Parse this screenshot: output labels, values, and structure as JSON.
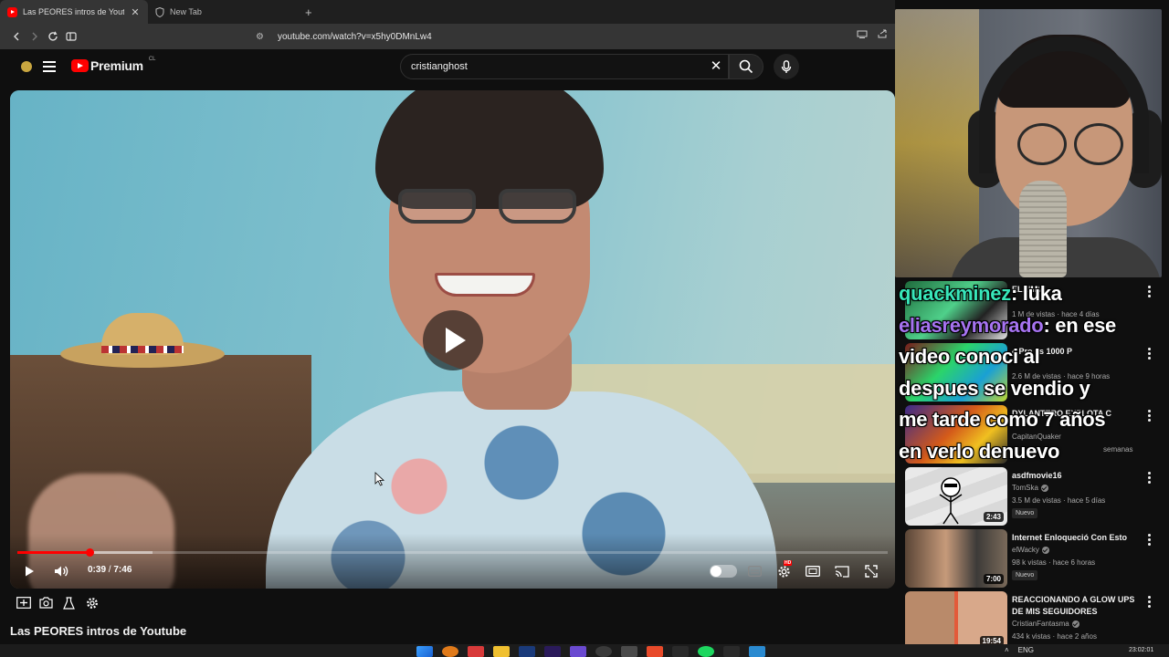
{
  "browser": {
    "tabs": [
      {
        "label": "Las PEORES intros de Youtube -",
        "icon": "youtube-favicon",
        "active": true
      },
      {
        "label": "New Tab",
        "icon": "shield-icon",
        "active": false
      }
    ],
    "new_tab_label": "+",
    "url": "youtube.com/watch?v=x5hy0DMnLw4"
  },
  "youtube": {
    "logo_text": "Premium",
    "country_code": "CL",
    "search_value": "cristianghost",
    "colors": {
      "brand": "#ff0000",
      "background": "#0f0f0f"
    }
  },
  "player": {
    "current_time": "0:39",
    "separator": " / ",
    "duration": "7:46",
    "progress_fraction": 0.0837,
    "buffered_fraction": 0.155,
    "hd_badge": "HD"
  },
  "video_title": "Las PEORES intros de Youtube",
  "chat": [
    {
      "user": "quackminez",
      "text": "lüka"
    },
    {
      "user": "eliasreymorado",
      "text": "en ese video conoci al despues se vendio y me tarde como 7 años en verlo denuevo"
    }
  ],
  "chat_lines": [
    {
      "user": "quackminez",
      "sep": ":",
      "text": " lüka"
    },
    {
      "user": "eliasreymorado",
      "sep": ":",
      "text": " en ese"
    },
    {
      "text": "video conoci al"
    },
    {
      "text": "despues se vendio y"
    },
    {
      "text": "me tarde como 7 años"
    },
    {
      "text": "en verlo denuevo"
    }
  ],
  "recommendations": [
    {
      "title": "ELANIMI",
      "channel": "",
      "meta": "1 M de vistas · hace 4 días",
      "duration": "",
      "new": false
    },
    {
      "title": "4 Pro vs 1000 P",
      "channel": "",
      "meta": "2.6 M de vistas · hace 9 horas",
      "duration": "",
      "new": false
    },
    {
      "title": "DYLANTERO EXPLOTA C",
      "channel": "CapitanQuaker",
      "meta": "semanas",
      "duration": "",
      "new": false
    },
    {
      "title": "asdfmovie16",
      "channel": "TomSka",
      "verified": true,
      "meta": "3.5 M de vistas · hace 5 días",
      "duration": "2:43",
      "new": true,
      "new_label": "Nuevo"
    },
    {
      "title": "Internet Enloqueció Con Esto",
      "channel": "elWacky",
      "verified": true,
      "meta": "98 k vistas · hace 6 horas",
      "duration": "7:00",
      "new": true,
      "new_label": "Nuevo"
    },
    {
      "title": "REACCIONANDO A GLOW UPS DE MIS SEGUIDORES",
      "channel": "CristianFantasma",
      "verified": true,
      "meta": "434 k vistas · hace 2 años",
      "duration": "19:54",
      "new": false
    }
  ],
  "taskbar": {
    "language": "ENG",
    "clock": "23:02:01"
  }
}
